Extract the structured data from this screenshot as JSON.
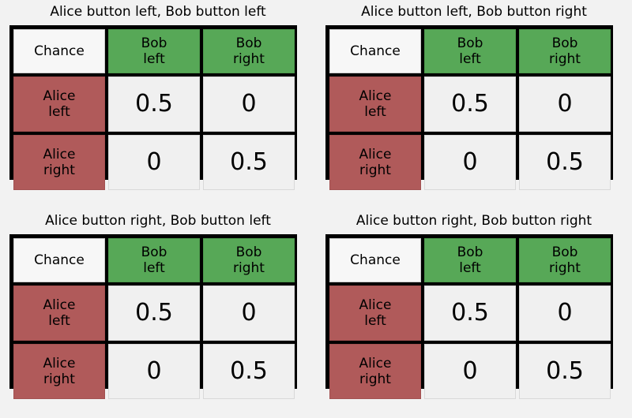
{
  "page": {
    "background_color": "#f2f2f2",
    "layout": "2x2 grid of probability tables"
  },
  "colors": {
    "background": "#f2f2f2",
    "border": "#000000",
    "column_header": "#57a857",
    "row_header": "#b05a5a",
    "corner_cell": "#f7f7f7",
    "value_cell": "#f0f0f0",
    "text": "#000000"
  },
  "labels": {
    "corner": "Chance",
    "col_head_1_line1": "Bob",
    "col_head_1_line2": "left",
    "col_head_2_line1": "Bob",
    "col_head_2_line2": "right",
    "row_head_1_line1": "Alice",
    "row_head_1_line2": "left",
    "row_head_2_line1": "Alice",
    "row_head_2_line2": "right"
  },
  "panels": [
    {
      "title": "Alice button left, Bob button left",
      "table": {
        "corner": "Chance",
        "columns": [
          "Bob left",
          "Bob right"
        ],
        "rows": [
          "Alice left",
          "Alice right"
        ],
        "values": [
          [
            "0.5",
            "0"
          ],
          [
            "0",
            "0.5"
          ]
        ]
      }
    },
    {
      "title": "Alice button left, Bob button right",
      "table": {
        "corner": "Chance",
        "columns": [
          "Bob left",
          "Bob right"
        ],
        "rows": [
          "Alice left",
          "Alice right"
        ],
        "values": [
          [
            "0.5",
            "0"
          ],
          [
            "0",
            "0.5"
          ]
        ]
      }
    },
    {
      "title": "Alice button right, Bob button left",
      "table": {
        "corner": "Chance",
        "columns": [
          "Bob left",
          "Bob right"
        ],
        "rows": [
          "Alice left",
          "Alice right"
        ],
        "values": [
          [
            "0.5",
            "0"
          ],
          [
            "0",
            "0.5"
          ]
        ]
      }
    },
    {
      "title": "Alice button right, Bob button right",
      "table": {
        "corner": "Chance",
        "columns": [
          "Bob left",
          "Bob right"
        ],
        "rows": [
          "Alice left",
          "Alice right"
        ],
        "values": [
          [
            "0.5",
            "0"
          ],
          [
            "0",
            "0.5"
          ]
        ]
      }
    }
  ],
  "chart_data": {
    "type": "table",
    "title": "Joint outcome probability tables for four button-press conditions",
    "panel_titles": [
      "Alice button left, Bob button left",
      "Alice button left, Bob button right",
      "Alice button right, Bob button left",
      "Alice button right, Bob button right"
    ],
    "row_label_header": "Chance",
    "columns": [
      "Bob left",
      "Bob right"
    ],
    "rows": [
      "Alice left",
      "Alice right"
    ],
    "panels": [
      {
        "name": "Alice button left, Bob button left",
        "values": [
          [
            0.5,
            0
          ],
          [
            0,
            0.5
          ]
        ]
      },
      {
        "name": "Alice button left, Bob button right",
        "values": [
          [
            0.5,
            0
          ],
          [
            0,
            0.5
          ]
        ]
      },
      {
        "name": "Alice button right, Bob button left",
        "values": [
          [
            0.5,
            0
          ],
          [
            0,
            0.5
          ]
        ]
      },
      {
        "name": "Alice button right, Bob button right",
        "values": [
          [
            0.5,
            0
          ],
          [
            0,
            0.5
          ]
        ]
      }
    ],
    "legend": [],
    "grid": true
  }
}
